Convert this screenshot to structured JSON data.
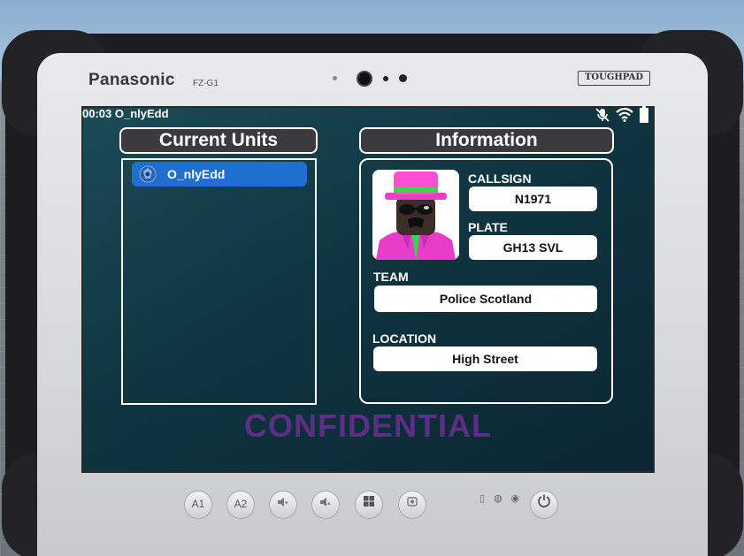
{
  "device": {
    "brand": "Panasonic",
    "model": "FZ-G1",
    "badge": "TOUGHPAD"
  },
  "status_bar": {
    "time": "00:03",
    "username": "O_nlyEdd",
    "icons": [
      "mic-muted-icon",
      "wifi-icon",
      "battery-icon"
    ]
  },
  "units_panel": {
    "title": "Current Units",
    "items": [
      {
        "label": "O_nlyEdd"
      }
    ]
  },
  "info_panel": {
    "title": "Information",
    "callsign_label": "CALLSIGN",
    "callsign": "N1971",
    "plate_label": "PLATE",
    "plate": "GH13 SVL",
    "team_label": "TEAM",
    "team": "Police Scotland",
    "location_label": "LOCATION",
    "location": "High Street"
  },
  "watermark": "CONFIDENTIAL",
  "hardware_buttons": {
    "a1": "A1",
    "a2": "A2"
  },
  "colors": {
    "selected_unit": "#1e6fcf",
    "panel_title_bg": "#3b3b3e",
    "watermark": "#5a2f84",
    "screen_bg": "#0e3540"
  }
}
